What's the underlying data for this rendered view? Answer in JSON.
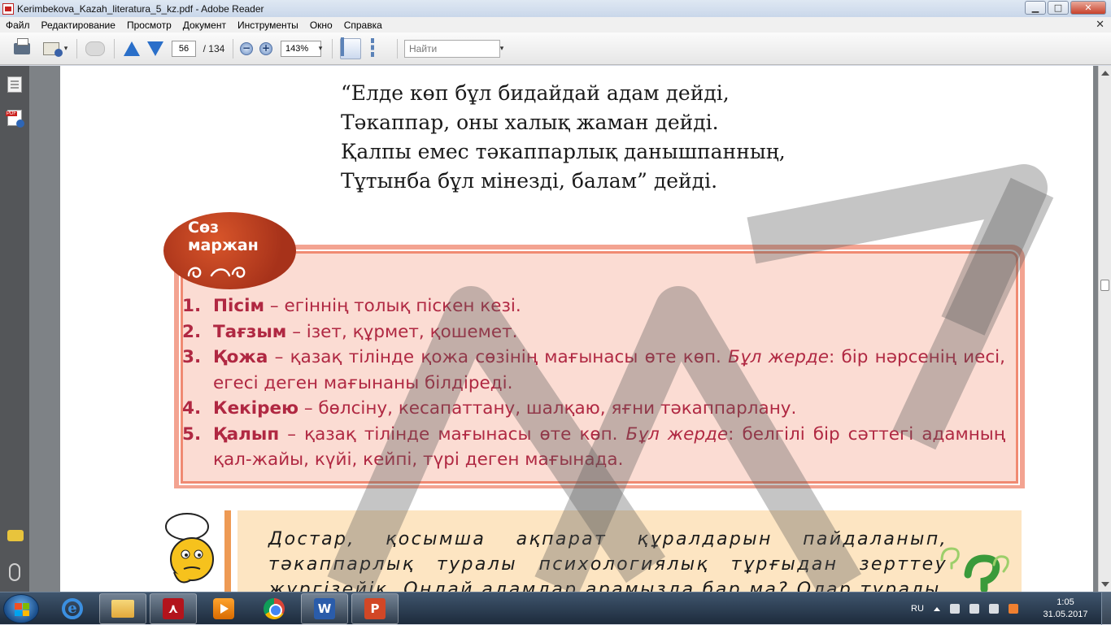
{
  "window": {
    "title": "Kerimbekova_Kazah_literatura_5_kz.pdf - Adobe Reader",
    "controls": {
      "minimize": "▁",
      "maximize": "□",
      "close": "✕"
    }
  },
  "menu": {
    "items": [
      "Файл",
      "Редактирование",
      "Просмотр",
      "Документ",
      "Инструменты",
      "Окно",
      "Справка"
    ],
    "close_glyph": "✕"
  },
  "toolbar": {
    "current_page": "56",
    "total_pages": "/ 134",
    "zoom_minus": "−",
    "zoom_plus": "+",
    "zoom": "143%",
    "find_placeholder": "Найти",
    "dropdown_glyph": "▾"
  },
  "document": {
    "poem": [
      "“Елде көп бұл бидайдай адам дейді,",
      "Тәкаппар, оны халық жаман дейді.",
      "Қалпы емес тәкаппарлық данышпанның,",
      "Тұтынба бұл мінезді, балам” дейді."
    ],
    "vocab_badge": {
      "line1": "Сөз",
      "line2": "маржан"
    },
    "definitions": [
      {
        "num": "1.",
        "term": "Пісім",
        "dash": " – ",
        "text": "егіннің толық піскен кезі.",
        "italic": "",
        "rest": ""
      },
      {
        "num": "2.",
        "term": "Тағзым",
        "dash": " – ",
        "text": "ізет, құрмет, қошемет.",
        "italic": "",
        "rest": ""
      },
      {
        "num": "3.",
        "term": "Қожа",
        "dash": " – ",
        "text": "қазақ тілінде қожа сөзінің мағынасы өте көп. ",
        "italic": "Бұл жерде",
        "rest": ": бір нәрсенің иесі, егесі деген мағынаны білдіреді."
      },
      {
        "num": "4.",
        "term": "Кекірею",
        "dash": " – ",
        "text": "бөлсіну, кесапаттану, шалқаю, яғни тәкаппарлану.",
        "italic": "",
        "rest": ""
      },
      {
        "num": "5.",
        "term": "Қалып",
        "dash": " – ",
        "text": "қазақ тілінде мағынасы өте көп. ",
        "italic": "Бұл жерде",
        "rest": ": белгілі бір сәттегі адамның қал-жайы, күйі, кейпі, түрі деген мағынада."
      }
    ],
    "task_text": "Достар, қосымша ақпарат құралдарын пайдаланып, тәкаппарлық туралы психологиялық тұрғыдан зерттеу жүргізейік. Ондай адамдар арамызда бар ма? Олар туралы"
  },
  "taskbar": {
    "word_letter": "W",
    "ppt_letter": "P",
    "ie_letter": "e",
    "language": "RU",
    "time": "1:05",
    "date": "31.05.2017"
  },
  "colors": {
    "accent_red": "#b02842",
    "vocab_bg": "#fbdcd3",
    "task_bg": "#fde5c2",
    "badge": "#a7321a"
  }
}
